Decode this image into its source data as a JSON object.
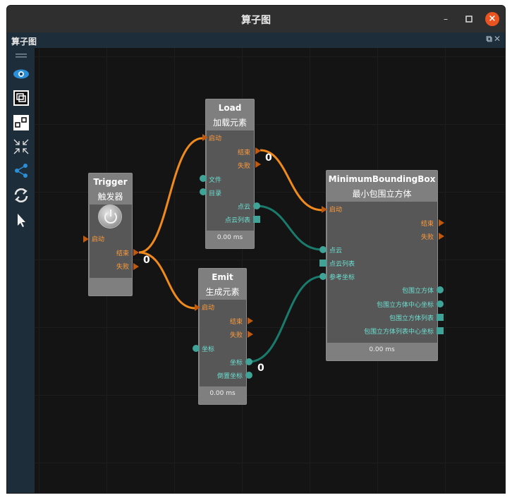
{
  "window": {
    "title": "算子图",
    "minimize": "–",
    "maximize": "□",
    "close": "×"
  },
  "panel": {
    "title": "算子图",
    "icons": "⧉✕"
  },
  "toolbar": {
    "items": [
      "grip-icon",
      "eye-icon",
      "fit-view-icon",
      "layout-icon",
      "collapse-icon",
      "graph-icon",
      "refresh-icon",
      "pointer-icon"
    ]
  },
  "nodes": {
    "trigger": {
      "name": "Trigger",
      "subtitle": "触发器",
      "inputs": [
        "启动"
      ],
      "outputs": [
        "结束",
        "失败"
      ],
      "footer": ""
    },
    "load": {
      "name": "Load",
      "subtitle": "加载元素",
      "inputs": [
        "启动",
        "文件",
        "目录"
      ],
      "outputs": [
        "结束",
        "失败",
        "点云",
        "点云列表"
      ],
      "footer": "0.00 ms"
    },
    "emit": {
      "name": "Emit",
      "subtitle": "生成元素",
      "inputs": [
        "启动",
        "坐标"
      ],
      "outputs": [
        "结束",
        "失败",
        "坐标",
        "倒置坐标"
      ],
      "footer": "0.00 ms"
    },
    "mbb": {
      "name": "MinimumBoundingBox",
      "subtitle": "最小包围立方体",
      "inputs": [
        "启动",
        "点云",
        "点云列表",
        "参考坐标"
      ],
      "outputs": [
        "结束",
        "失败",
        "包围立方体",
        "包围立方体中心坐标",
        "包围立方体列表",
        "包围立方体列表中心坐标"
      ],
      "footer": "0.00 ms"
    }
  },
  "connection_counts": {
    "trigger_done": "0",
    "load_done": "0",
    "emit_coord": "0"
  },
  "colors": {
    "flow_wire": "#f08a1c",
    "data_wire": "#1a7a6c",
    "flow_port": "#c0580e",
    "data_port": "#40a398"
  }
}
